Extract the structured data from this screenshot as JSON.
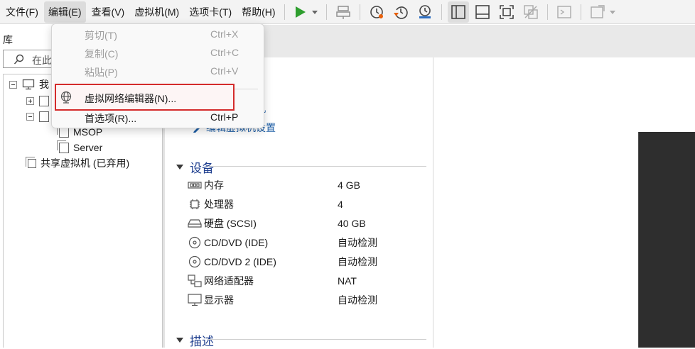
{
  "menubar": {
    "items": [
      "文件(F)",
      "编辑(E)",
      "查看(V)",
      "虚拟机(M)",
      "选项卡(T)",
      "帮助(H)"
    ]
  },
  "toolbar": {
    "icons": [
      "play-icon",
      "dropdown-arrow-icon",
      "send-keys-icon",
      "snapshot-icon",
      "revert-snapshot-icon",
      "manage-snapshots-icon",
      "library-view-icon",
      "thumbnail-bar-icon",
      "fullscreen-icon",
      "unity-icon",
      "console-icon",
      "stretch-icon"
    ],
    "accent_play": "#2e9e2e",
    "accent_snapshot": "#e8600c"
  },
  "library": {
    "title": "库",
    "search_placeholder": "在此",
    "tree": [
      {
        "label": "我",
        "level": 0,
        "expander": "minus",
        "icon": "computer-icon"
      },
      {
        "label": "",
        "level": 1,
        "expander": "plus",
        "icon": "vm-icon"
      },
      {
        "label": "",
        "level": 1,
        "expander": "minus",
        "icon": "vm-icon"
      },
      {
        "label": "MSOP",
        "level": 2,
        "icon": "vm-icon"
      },
      {
        "label": "Server",
        "level": 2,
        "icon": "vm-icon"
      },
      {
        "label": "共享虚拟机 (已弃用)",
        "level": 0,
        "icon": "shared-vm-icon"
      }
    ]
  },
  "details": {
    "link1_suffix": "机",
    "link2": "编辑虚拟机设置",
    "devices_title": "设备",
    "devices": [
      {
        "icon": "memory-icon",
        "name": "内存",
        "value": "4 GB"
      },
      {
        "icon": "processor-icon",
        "name": "处理器",
        "value": "4"
      },
      {
        "icon": "hard-disk-icon",
        "name": "硬盘 (SCSI)",
        "value": "40 GB"
      },
      {
        "icon": "cd-dvd-icon",
        "name": "CD/DVD (IDE)",
        "value": "自动检测"
      },
      {
        "icon": "cd-dvd-icon",
        "name": "CD/DVD 2 (IDE)",
        "value": "自动检测"
      },
      {
        "icon": "network-adapter-icon",
        "name": "网络适配器",
        "value": "NAT"
      },
      {
        "icon": "display-icon",
        "name": "显示器",
        "value": "自动检测"
      }
    ],
    "description_title": "描述"
  },
  "edit_menu": {
    "items": [
      {
        "label": "剪切(T)",
        "shortcut": "Ctrl+X",
        "enabled": false
      },
      {
        "label": "复制(C)",
        "shortcut": "Ctrl+C",
        "enabled": false
      },
      {
        "label": "粘贴(P)",
        "shortcut": "Ctrl+V",
        "enabled": false
      },
      {
        "label": "虚拟网络编辑器(N)...",
        "shortcut": "",
        "enabled": true,
        "icon": "globe-network-icon",
        "highlighted": true
      },
      {
        "label": "首选项(R)...",
        "shortcut": "Ctrl+P",
        "enabled": true
      }
    ],
    "highlight_color": "#d42b2b"
  }
}
